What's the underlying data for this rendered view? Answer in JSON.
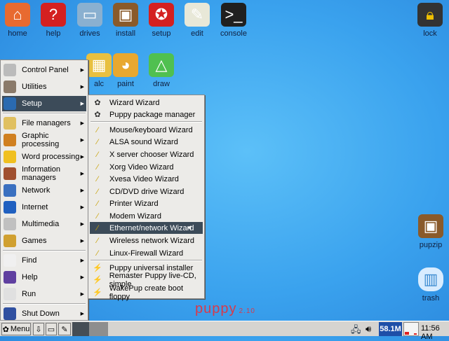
{
  "desktop": {
    "icons": [
      {
        "label": "home",
        "icon": "home-icon",
        "color": "#e86a30",
        "glyph": "⌂"
      },
      {
        "label": "help",
        "icon": "help-icon",
        "color": "#d42020",
        "glyph": "?"
      },
      {
        "label": "drives",
        "icon": "usb-drive-icon",
        "color": "#8ab0d0",
        "glyph": "▭"
      },
      {
        "label": "install",
        "icon": "package-icon",
        "color": "#8a5a2a",
        "glyph": "▣"
      },
      {
        "label": "setup",
        "icon": "setup-icon",
        "color": "#d42020",
        "glyph": "✪"
      },
      {
        "label": "edit",
        "icon": "edit-icon",
        "color": "#e8e8d8",
        "glyph": "✎"
      },
      {
        "label": "console",
        "icon": "console-icon",
        "color": "#202020",
        "glyph": ">_"
      }
    ],
    "row2": [
      {
        "label": "alc",
        "icon": "calc-icon",
        "color": "#e8c040",
        "glyph": "▦"
      },
      {
        "label": "paint",
        "icon": "paint-palette-icon",
        "color": "#e8a830",
        "glyph": "◕"
      },
      {
        "label": "draw",
        "icon": "draw-icon",
        "color": "#50c050",
        "glyph": "△"
      }
    ],
    "lock": "lock",
    "pupzip": "pupzip",
    "trash": "trash",
    "logo": "puppy",
    "version": "2.10"
  },
  "menu": {
    "items": [
      {
        "label": "Control Panel",
        "arrow": true
      },
      {
        "label": "Utilities",
        "arrow": true
      },
      {
        "label": "Setup",
        "arrow": true,
        "selected": true
      },
      {
        "label": "File managers",
        "arrow": true
      },
      {
        "label": "Graphic processing",
        "arrow": true
      },
      {
        "label": "Word processing",
        "arrow": true
      },
      {
        "label": "Information managers",
        "arrow": true
      },
      {
        "label": "Network",
        "arrow": true
      },
      {
        "label": "Internet",
        "arrow": true
      },
      {
        "label": "Multimedia",
        "arrow": true
      },
      {
        "label": "Games",
        "arrow": true
      },
      {
        "label": "Find",
        "arrow": true
      },
      {
        "label": "Help",
        "arrow": true
      },
      {
        "label": "Run",
        "arrow": true
      },
      {
        "label": "Shut Down",
        "arrow": true
      }
    ]
  },
  "submenu": {
    "items": [
      "Wizard Wizard",
      "Puppy package manager",
      "Mouse/keyboard Wizard",
      "ALSA sound Wizard",
      "X server chooser Wizard",
      "Xorg Video Wizard",
      "Xvesa Video Wizard",
      "CD/DVD drive Wizard",
      "Printer Wizard",
      "Modem Wizard",
      "Ethernet/network Wizard",
      "Wireless network Wizard",
      "Linux-Firewall Wizard",
      "Puppy universal installer",
      "Remaster Puppy live-CD, simple",
      "WakePup create boot floppy"
    ],
    "selected": "Ethernet/network Wizard"
  },
  "taskbar": {
    "menu_label": "Menu",
    "memory": "58.1M",
    "clock": "11:56 AM"
  }
}
